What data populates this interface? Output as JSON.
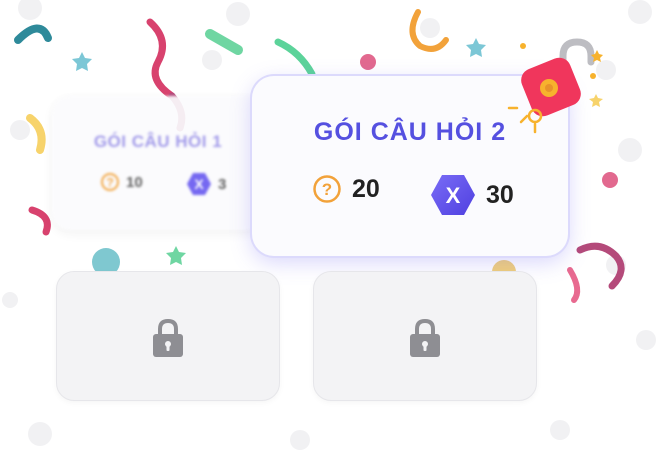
{
  "packs": [
    {
      "title": "GÓI CÂU HỎI 1",
      "questions": "10",
      "reward": "3",
      "state": "unlocked"
    },
    {
      "title": "GÓI CÂU HỎI 2",
      "questions": "20",
      "reward": "30",
      "state": "unlocking"
    },
    {
      "state": "locked"
    },
    {
      "state": "locked"
    }
  ],
  "icons": {
    "question": "question-circle-icon",
    "reward": "x-hexagon-icon",
    "lock": "padlock-icon",
    "unlock": "open-padlock-icon"
  },
  "colors": {
    "accent": "#5550e0",
    "reward_hex": "#6a5cf0",
    "question_orange": "#f2a23a",
    "lock_grey": "#8e8e93",
    "unlock_red": "#f0365c",
    "unlock_yellow": "#f7b22d"
  },
  "reward_glyph": "X"
}
